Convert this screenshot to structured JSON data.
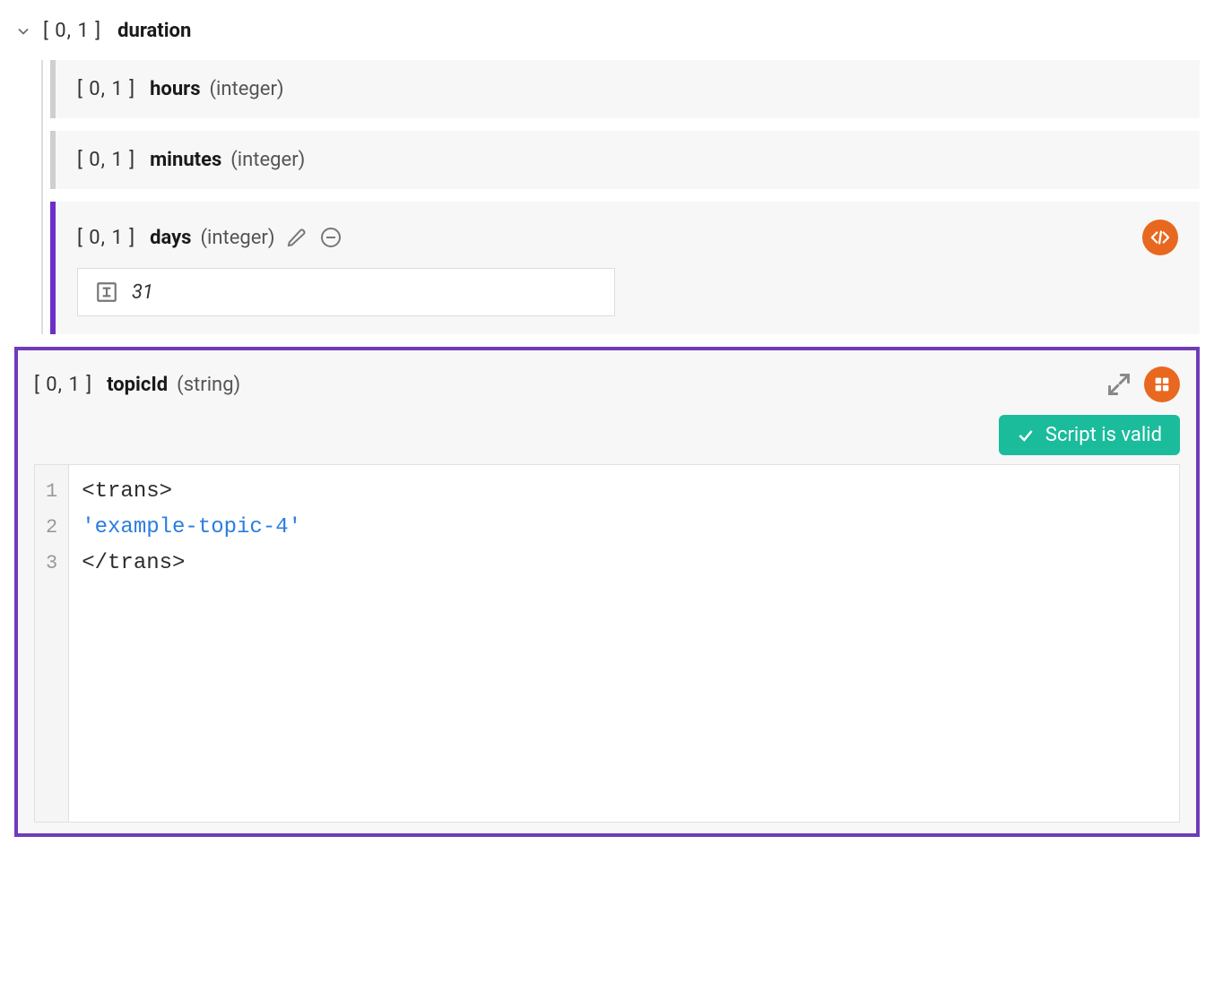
{
  "cardinality_label": "[ 0, 1 ]",
  "duration": {
    "label": "duration",
    "children": {
      "hours": {
        "label": "hours",
        "type": "(integer)"
      },
      "minutes": {
        "label": "minutes",
        "type": "(integer)"
      },
      "days": {
        "label": "days",
        "type": "(integer)",
        "value": "31"
      }
    }
  },
  "topic": {
    "label": "topicId",
    "type": "(string)",
    "status": "Script is valid",
    "code": {
      "line1": "<trans>",
      "line2": "'example-topic-4'",
      "line3": "</trans>",
      "ln1": "1",
      "ln2": "2",
      "ln3": "3"
    }
  }
}
